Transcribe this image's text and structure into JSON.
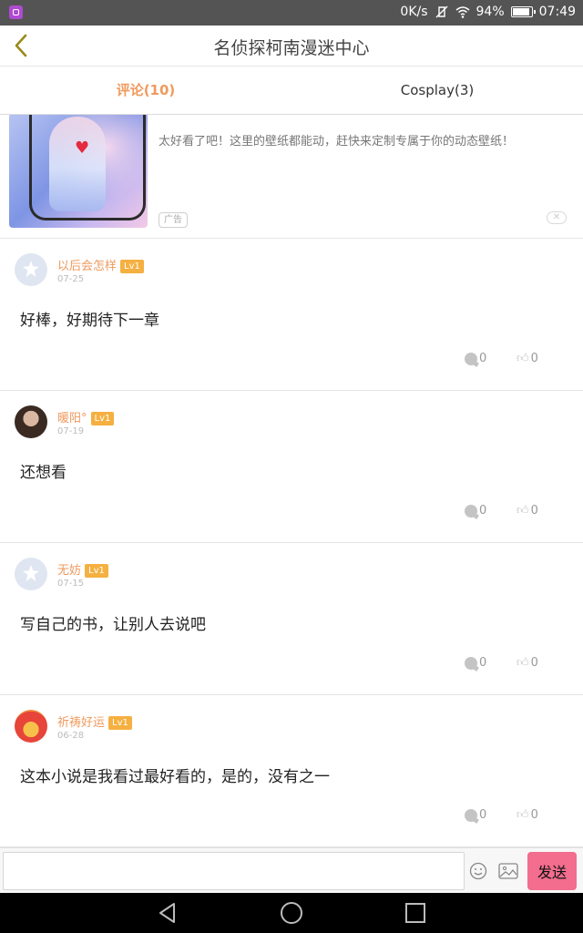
{
  "status_bar": {
    "network_speed": "0K/s",
    "battery": "94%",
    "battery_level": 0.94,
    "time": "07:49"
  },
  "header": {
    "title": "名侦探柯南漫迷中心"
  },
  "tabs": [
    {
      "label": "评论(10)",
      "active": true
    },
    {
      "label": "Cosplay(3)",
      "active": false
    }
  ],
  "ad": {
    "text": "太好看了吧！这里的壁纸都能动，赶快来定制专属于你的动态壁纸！",
    "badge": "广告",
    "close": "✕"
  },
  "comments": [
    {
      "username": "以后会怎样",
      "level": "Lv1",
      "date": "07-25",
      "text": "好棒，好期待下一章",
      "replies": "0",
      "likes": "0"
    },
    {
      "username": "暖阳°",
      "level": "Lv1",
      "date": "07-19",
      "text": "还想看",
      "replies": "0",
      "likes": "0"
    },
    {
      "username": "无妨",
      "level": "Lv1",
      "date": "07-15",
      "text": "写自己的书，让别人去说吧",
      "replies": "0",
      "likes": "0"
    },
    {
      "username": "祈祷好运",
      "level": "Lv1",
      "date": "06-28",
      "text": "这本小说是我看过最好看的，是的，没有之一",
      "replies": "0",
      "likes": "0"
    }
  ],
  "input_bar": {
    "value": "",
    "send_label": "发送"
  },
  "colors": {
    "accent": "#f09a5e",
    "level_badge": "#f5b041",
    "send_button": "#f26d8e"
  }
}
